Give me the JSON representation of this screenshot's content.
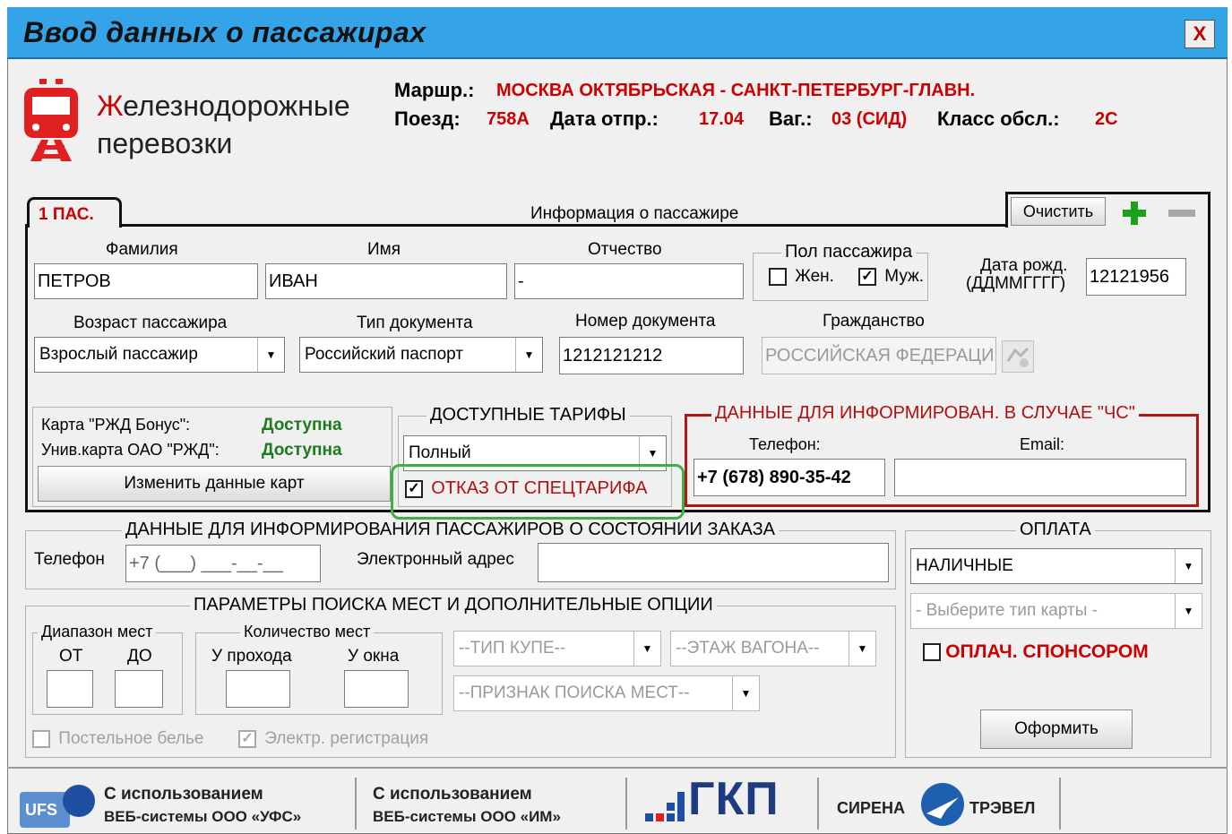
{
  "window": {
    "title": "Ввод данных о пассажирах",
    "close_symbol": "X"
  },
  "header": {
    "logo_line1": "Железнодорожные",
    "logo_line2": "перевозки",
    "route_label": "Маршр.:",
    "route_value": "МОСКВА ОКТЯБРЬСКАЯ - САНКТ-ПЕТЕРБУРГ-ГЛАВН.",
    "train_label": "Поезд:",
    "train_value": "758А",
    "date_label": "Дата отпр.:",
    "date_value": "17.04",
    "car_label": "Ваг.:",
    "car_value": "03 (СИД)",
    "class_label": "Класс обсл.:",
    "class_value": "2С"
  },
  "passenger": {
    "tab_label": "1 ПАС.",
    "section_title": "Информация о пассажире",
    "clear_button": "Очистить",
    "surname_label": "Фамилия",
    "surname_value": "ПЕТРОВ",
    "name_label": "Имя",
    "name_value": "ИВАН",
    "patronymic_label": "Отчество",
    "patronymic_value": "-",
    "gender_title": "Пол пассажира",
    "gender_female": "Жен.",
    "gender_male": "Муж.",
    "birth_label_1": "Дата рожд.",
    "birth_label_2": "(ДДММГГГГ)",
    "birth_value": "12121956",
    "age_label": "Возраст пассажира",
    "age_value": "Взрослый пассажир",
    "doctype_label": "Тип документа",
    "doctype_value": "Российский паспорт",
    "docnum_label": "Номер документа",
    "docnum_value": "1212121212",
    "citizenship_label": "Гражданство",
    "citizenship_value": "РОССИЙСКАЯ ФЕДЕРАЦИ",
    "bonus_label": "Карта \"РЖД Бонус\":",
    "bonus_value": "Доступна",
    "univ_label": "Унив.карта ОАО \"РЖД\":",
    "univ_value": "Доступна",
    "change_cards_button": "Изменить данные карт",
    "tariffs_title": "ДОСТУПНЫЕ ТАРИФЫ",
    "tariff_value": "Полный",
    "refuse_special": "ОТКАЗ ОТ СПЕЦТАРИФА",
    "emergency_title": "ДАННЫЕ ДЛЯ ИНФОРМИРОВАН. В СЛУЧАЕ \"ЧС\"",
    "emergency_phone_label": "Телефон:",
    "emergency_phone_value": "+7 (678) 890-35-42",
    "emergency_email_label": "Email:"
  },
  "notify": {
    "title": "ДАННЫЕ ДЛЯ ИНФОРМИРОВАНИЯ ПАССАЖИРОВ О СОСТОЯНИИ ЗАКАЗА",
    "phone_label": "Телефон",
    "phone_value": "+7 (___) ___-__-__",
    "email_label": "Электронный адрес"
  },
  "payment": {
    "title": "ОПЛАТА",
    "method_value": "НАЛИЧНЫЕ",
    "card_placeholder": "- Выберите тип карты -",
    "sponsor_label": "ОПЛАЧ. СПОНСОРОМ",
    "submit_button": "Оформить"
  },
  "search": {
    "title": "ПАРАМЕТРЫ ПОИСКА МЕСТ И ДОПОЛНИТЕЛЬНЫЕ ОПЦИИ",
    "range_title": "Диапазон мест",
    "from_label": "ОТ",
    "to_label": "ДО",
    "count_title": "Количество мест",
    "aisle_label": "У прохода",
    "window_label": "У окна",
    "compartment_type": "--ТИП КУПЕ--",
    "car_floor": "--ЭТАЖ ВАГОНА--",
    "seat_search_sign": "--ПРИЗНАК ПОИСКА МЕСТ--",
    "bedding_label": "Постельное белье",
    "eregistration_label": "Электр. регистрация"
  },
  "footer": {
    "ufs_line1": "С использованием",
    "ufs_line2": "ВЕБ-системы ООО «УФС»",
    "ufs_logo": "UFS",
    "im_line1": "С использованием",
    "im_line2": "ВЕБ-системы ООО «ИМ»",
    "gkp_logo": "ГКП",
    "sirena_left": "СИРЕНА",
    "sirena_right": "ТРЭВЕЛ"
  },
  "colors": {
    "titlebar": "#35a3e8",
    "accent_red": "#cc0000",
    "available_green": "#1f7a1f",
    "highlight_green": "#3cb043"
  }
}
